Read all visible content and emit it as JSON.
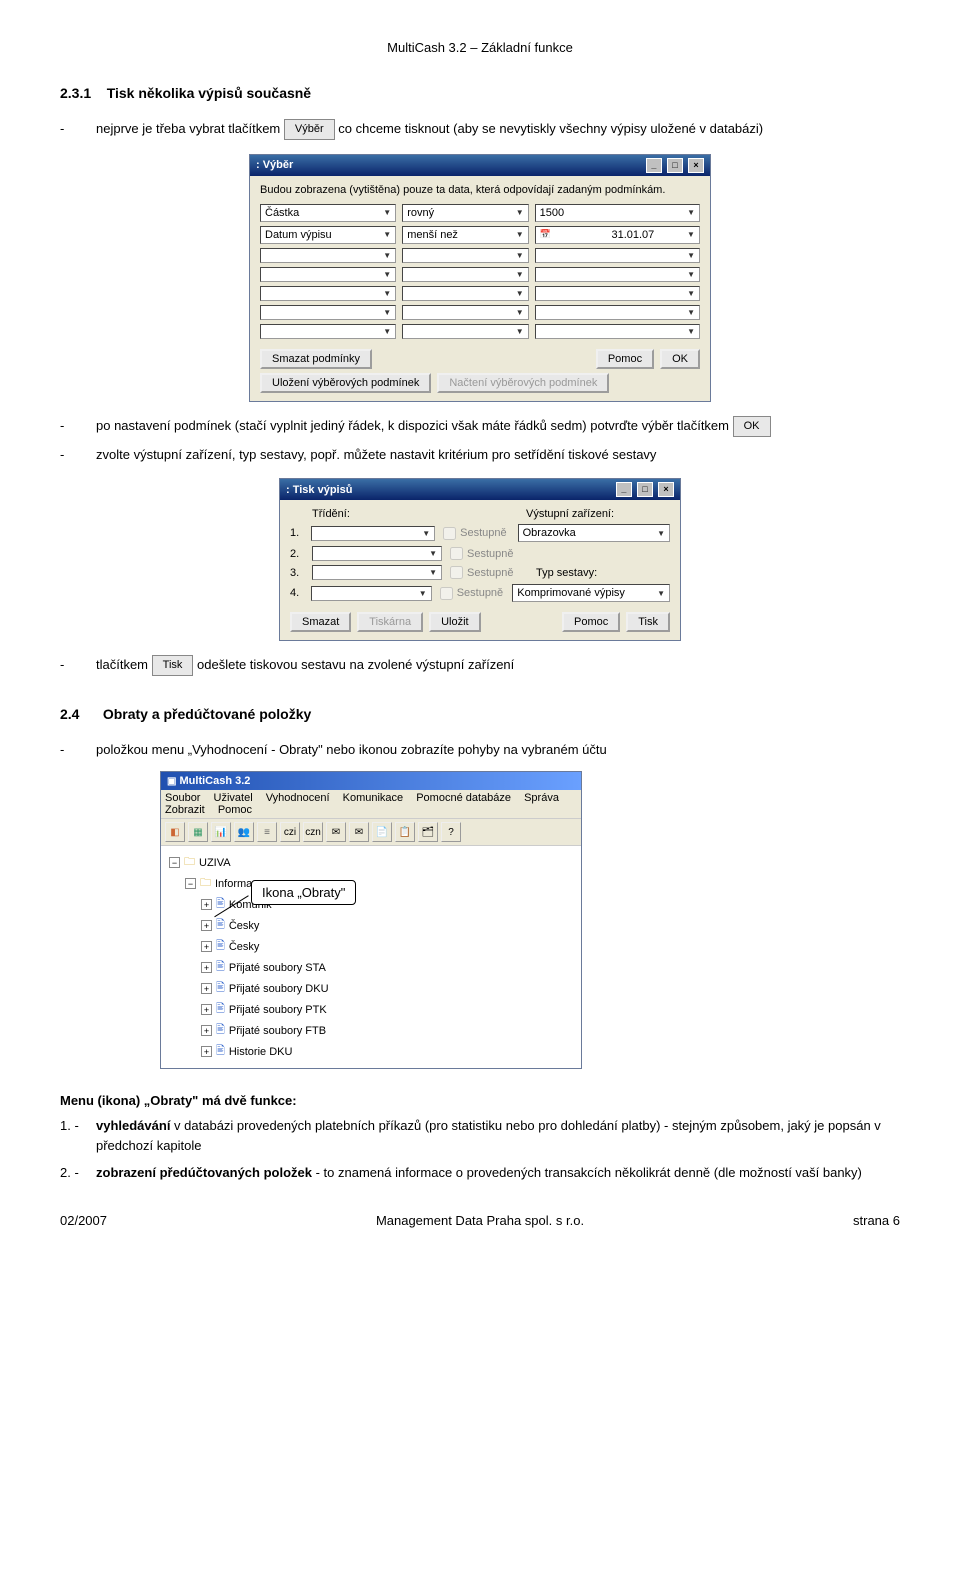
{
  "header": {
    "title": "MultiCash 3.2 – Základní funkce"
  },
  "section231": {
    "number": "2.3.1",
    "title": "Tisk několika výpisů současně",
    "bullet1_pre": "nejprve je třeba vybrat tlačítkem",
    "bullet1_btn": "Výběr",
    "bullet1_post": "co chceme tisknout (aby se nevytiskly všechny výpisy uložené v databázi)"
  },
  "vyber_window": {
    "title": ": Výběr",
    "info": "Budou zobrazena (vytištěna) pouze ta data, která odpovídají zadaným podmínkám.",
    "row1": {
      "field": "Částka",
      "op": "rovný",
      "val": "1500"
    },
    "row2": {
      "field": "Datum výpisu",
      "op": "menší než",
      "val": "31.01.07"
    },
    "btn_clear": "Smazat podmínky",
    "btn_save": "Uložení výběrových podmínek",
    "btn_load": "Načtení výběrových podmínek",
    "btn_help": "Pomoc",
    "btn_ok": "OK"
  },
  "bullet2": {
    "pre": "po nastavení podmínek (stačí vyplnit jediný řádek, k dispozici však máte řádků sedm) potvrďte výběr tlačítkem",
    "btn": "OK"
  },
  "bullet3": "zvolte výstupní zařízení, typ sestavy, popř. můžete nastavit kritérium pro setřídění tiskové sestavy",
  "tisk_window": {
    "title": ": Tisk výpisů",
    "col_trideni": "Třídění:",
    "col_vystup": "Výstupní zařízení:",
    "chk_sestupne": "Sestupně",
    "label_typ": "Typ sestavy:",
    "out1": "Obrazovka",
    "out2": "Komprimované výpisy",
    "btn_smazat": "Smazat",
    "btn_tiskarna": "Tiskárna",
    "btn_ulozit": "Uložit",
    "btn_pomoc": "Pomoc",
    "btn_tisk": "Tisk"
  },
  "bullet4": {
    "pre": "tlačítkem",
    "btn": "Tisk",
    "post": "odešlete tiskovou sestavu na zvolené výstupní zařízení"
  },
  "section24": {
    "number": "2.4",
    "title": "Obraty a předúčtované položky",
    "bullet1": "položkou menu „Vyhodnocení - Obraty\" nebo ikonou zobrazíte pohyby na vybraném účtu"
  },
  "mc_window": {
    "title": "MultiCash 3.2",
    "menu": [
      "Soubor",
      "Uživatel",
      "Vyhodnocení",
      "Komunikace",
      "Pomocné databáze",
      "Správa",
      "Zobrazit",
      "Pomoc"
    ],
    "tree": {
      "root": "UZIVA",
      "informace": "Informace",
      "komunika": "Komunik",
      "cesky1": "Česky",
      "cesky2": "Česky",
      "sta": "Přijaté soubory STA",
      "dku": "Přijaté soubory DKU",
      "ptk": "Přijaté soubory PTK",
      "ftb": "Přijaté soubory FTB",
      "hist": "Historie DKU"
    },
    "callout": "Ikona „Obraty\""
  },
  "menu_funkce": {
    "heading": "Menu (ikona) „Obraty\" má dvě funkce:",
    "item1_num": "1. -",
    "item1_bold": "vyhledávání",
    "item1_rest": " v databázi provedených platebních příkazů (pro statistiku nebo pro dohledání platby) - stejným způsobem, jaký je popsán v předchozí kapitole",
    "item2_num": "2. -",
    "item2_bold": "zobrazení předúčtovaných položek",
    "item2_rest": " - to znamená informace o provedených transakcích několikrát denně (dle možností vaší banky)"
  },
  "footer": {
    "left": "02/2007",
    "center": "Management Data Praha spol. s r.o.",
    "right": "strana 6"
  }
}
